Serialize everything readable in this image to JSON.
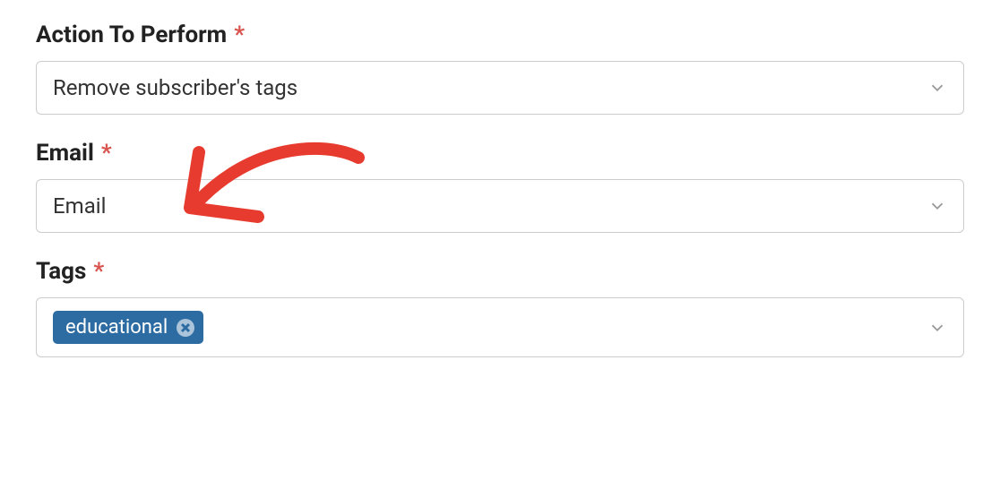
{
  "fields": {
    "action": {
      "label": "Action To Perform",
      "required_mark": "*",
      "value": "Remove subscriber's tags"
    },
    "email": {
      "label": "Email",
      "required_mark": "*",
      "value": "Email"
    },
    "tags": {
      "label": "Tags",
      "required_mark": "*",
      "selected": "educational"
    }
  }
}
